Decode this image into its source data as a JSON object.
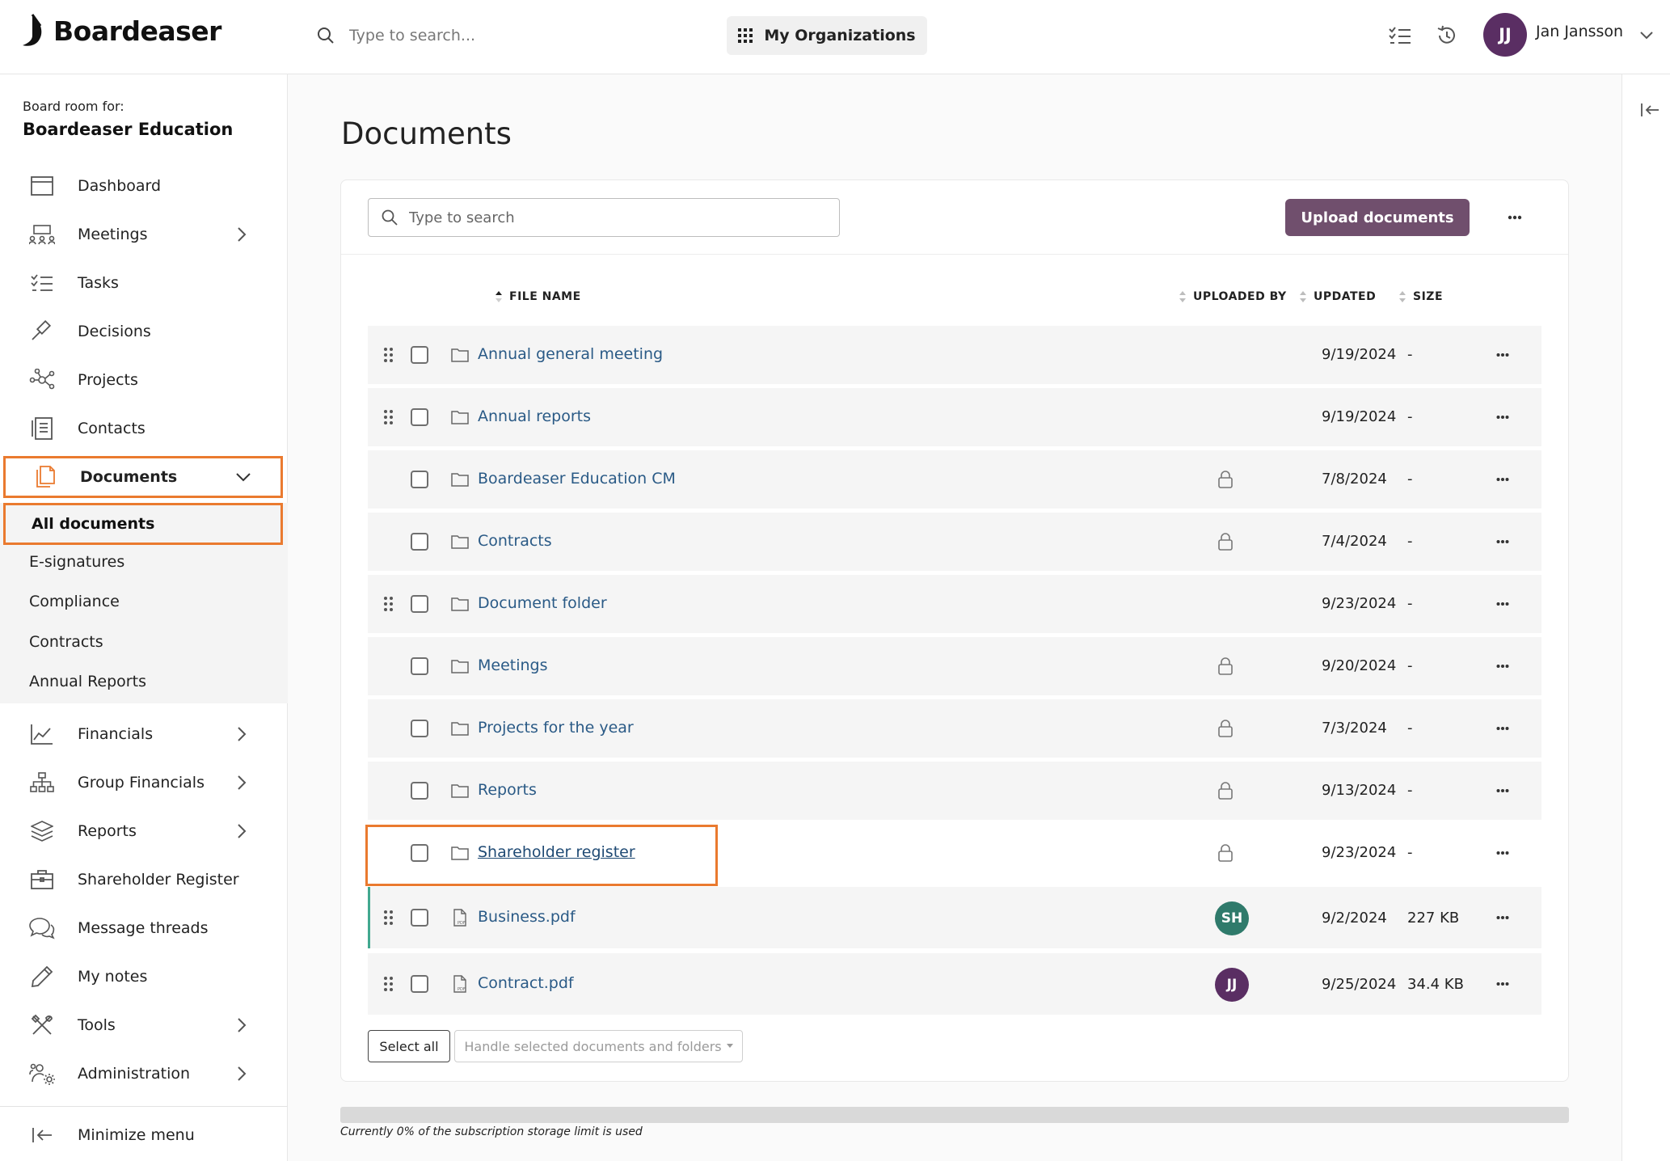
{
  "brand": {
    "name": "Boardeaser"
  },
  "header": {
    "search_placeholder": "Type to search...",
    "org_button": "My Organizations",
    "user": {
      "initials": "JJ",
      "name": "Jan Jansson"
    }
  },
  "sidebar": {
    "board_label": "Board room for:",
    "board_name": "Boardeaser Education",
    "items": [
      {
        "label": "Dashboard",
        "icon": "calendar-icon"
      },
      {
        "label": "Meetings",
        "icon": "meeting-icon"
      },
      {
        "label": "Tasks",
        "icon": "tasks-icon"
      },
      {
        "label": "Decisions",
        "icon": "gavel-icon"
      },
      {
        "label": "Projects",
        "icon": "projects-icon"
      },
      {
        "label": "Contacts",
        "icon": "contacts-icon"
      },
      {
        "label": "Documents",
        "icon": "documents-icon"
      },
      {
        "label": "Financials",
        "icon": "chart-line-icon"
      },
      {
        "label": "Group Financials",
        "icon": "org-chart-icon"
      },
      {
        "label": "Reports",
        "icon": "layers-icon"
      },
      {
        "label": "Shareholder Register",
        "icon": "briefcase-icon"
      },
      {
        "label": "Message threads",
        "icon": "chat-icon"
      },
      {
        "label": "My notes",
        "icon": "pencil-icon"
      },
      {
        "label": "Tools",
        "icon": "tools-icon"
      },
      {
        "label": "Administration",
        "icon": "admin-icon"
      }
    ],
    "documents_sub": [
      "All documents",
      "E-signatures",
      "Compliance",
      "Contracts",
      "Annual Reports"
    ],
    "minimize": "Minimize menu"
  },
  "main": {
    "title": "Documents",
    "search_placeholder": "Type to search",
    "upload_button": "Upload documents",
    "columns": {
      "file_name": "FILE NAME",
      "uploaded_by": "UPLOADED BY",
      "updated": "UPDATED",
      "size": "SIZE"
    },
    "rows": [
      {
        "name": "Annual general meeting",
        "type": "folder",
        "updated": "9/19/2024",
        "size": "-"
      },
      {
        "name": "Annual reports",
        "type": "folder",
        "updated": "9/19/2024",
        "size": "-"
      },
      {
        "name": "Boardeaser Education CM",
        "type": "folder",
        "updated": "7/8/2024",
        "size": "-"
      },
      {
        "name": "Contracts",
        "type": "folder",
        "updated": "7/4/2024",
        "size": "-"
      },
      {
        "name": "Document folder",
        "type": "folder",
        "updated": "9/23/2024",
        "size": "-"
      },
      {
        "name": "Meetings",
        "type": "folder",
        "updated": "9/20/2024",
        "size": "-"
      },
      {
        "name": "Projects for the year",
        "type": "folder",
        "updated": "7/3/2024",
        "size": "-"
      },
      {
        "name": "Reports",
        "type": "folder",
        "updated": "9/13/2024",
        "size": "-"
      },
      {
        "name": "Shareholder register",
        "type": "folder",
        "updated": "9/23/2024",
        "size": "-"
      },
      {
        "name": "Business.pdf",
        "type": "pdf",
        "uploader": "SH",
        "uploader_color": "#2f7a6b",
        "updated": "9/2/2024",
        "size": "227 KB"
      },
      {
        "name": "Contract.pdf",
        "type": "pdf",
        "uploader": "JJ",
        "uploader_color": "#5a2e63",
        "updated": "9/25/2024",
        "size": "34.4 KB"
      }
    ],
    "select_all": "Select all",
    "handle_selected": "Handle selected documents and folders",
    "storage": {
      "used_fraction": 0,
      "text": "Currently 0% of the subscription storage limit is used"
    }
  },
  "colors": {
    "accent": "#704f6d",
    "highlight": "#ea7a2f",
    "link": "#2a5a86"
  }
}
